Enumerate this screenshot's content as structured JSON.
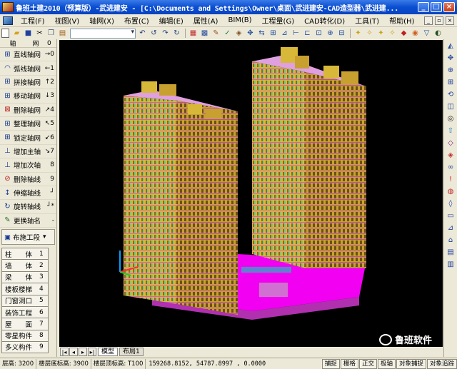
{
  "window": {
    "title": "鲁班土建2010（预算版）-武进建安 - [C:\\Documents and Settings\\Owner\\桌面\\武进建安-CAD造型器\\武进建..."
  },
  "menu": [
    "工程(F)",
    "视图(V)",
    "轴网(X)",
    "布置(C)",
    "编辑(E)",
    "属性(A)",
    "BIM(B)",
    "工程量(G)",
    "CAD转化(D)",
    "工具(T)",
    "帮助(H)"
  ],
  "left_panel": {
    "header_left": "轴",
    "header_mid": "网",
    "header_right": "0",
    "commands": [
      {
        "icon": "straight-axis-icon",
        "label": "直线轴网",
        "key": "→0"
      },
      {
        "icon": "arc-axis-icon",
        "label": "弧线轴网",
        "key": "←1"
      },
      {
        "icon": "splice-axis-icon",
        "label": "拼接轴网",
        "key": "↑2"
      },
      {
        "icon": "move-axis-icon",
        "label": "移动轴网",
        "key": "↓3"
      },
      {
        "icon": "delete-axis-icon",
        "label": "删除轴网",
        "key": "↗4"
      },
      {
        "icon": "rotate-axis-icon",
        "label": "整理轴网",
        "key": "↖5"
      },
      {
        "icon": "lock-axis-icon",
        "label": "锁定轴网",
        "key": "↙6"
      },
      {
        "icon": "add-main-axis-icon",
        "label": "增加主轴",
        "key": "↘7"
      },
      {
        "icon": "add-sub-axis-icon",
        "label": "增加次轴",
        "key": "8"
      },
      {
        "icon": "delete-axis-line-icon",
        "label": "删除轴线",
        "key": "9"
      },
      {
        "icon": "extend-axis-icon",
        "label": "伸缩轴线",
        "key": "┘"
      },
      {
        "icon": "rotate-axis-line-icon",
        "label": "旋转轴线",
        "key": "┘*"
      },
      {
        "icon": "rename-axis-icon",
        "label": "更换轴名",
        "key": "-"
      }
    ],
    "dropdown_label": "布施工段",
    "modules": [
      {
        "label": "柱　　体",
        "num": "1"
      },
      {
        "label": "墙　　体",
        "num": "2"
      },
      {
        "label": "梁　　体",
        "num": "3"
      },
      {
        "label": "楼板楼梯",
        "num": "4"
      },
      {
        "label": "门窗洞口",
        "num": "5"
      },
      {
        "label": "装饰工程",
        "num": "6"
      },
      {
        "label": "屋　　面",
        "num": "7"
      },
      {
        "label": "零星构件",
        "num": "8"
      },
      {
        "label": "多义构件",
        "num": "9"
      }
    ]
  },
  "viewport": {
    "tabs": [
      "模型",
      "布局1"
    ]
  },
  "statusbar": {
    "floor_height": "层高: 3200",
    "floor_bottom": "楼层底标高: 3900",
    "floor_top": "楼层顶标高: T100",
    "coords": "159268.8152,  54787.8997 ,  0.0000",
    "toggles": [
      "捕捉",
      "栅格",
      "正交",
      "极轴",
      "对象捕捉",
      "对象追踪"
    ]
  },
  "watermark": {
    "text": "鲁班软件"
  },
  "colors": {
    "titlebar": "#0a4ed1",
    "viewport_bg": "#000000",
    "building_yellow": "#e8c840",
    "podium_magenta": "#ff00ff"
  }
}
